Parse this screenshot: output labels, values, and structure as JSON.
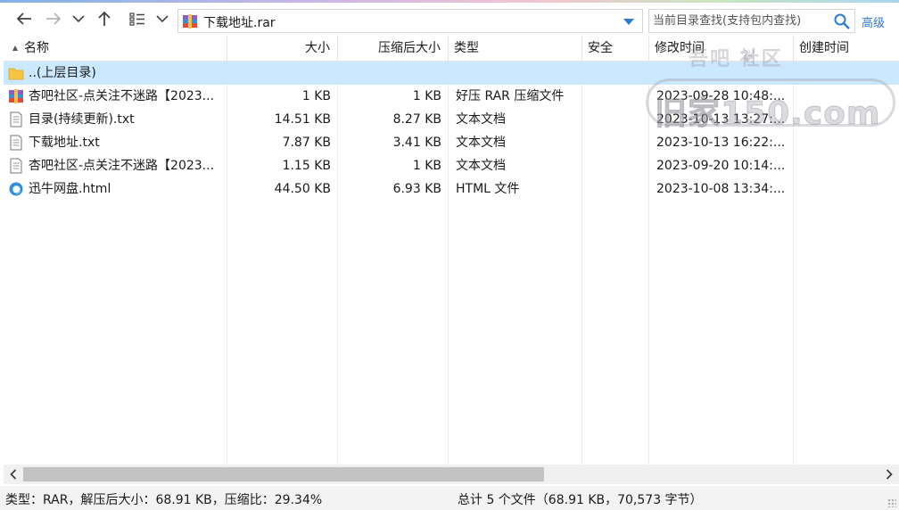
{
  "toolbar": {
    "address": "下载地址.rar",
    "search_placeholder": "当前目录查找(支持包内查找)",
    "advanced_label": "高级"
  },
  "columns": {
    "name": "名称",
    "size": "大小",
    "packed": "压缩后大小",
    "type": "类型",
    "security": "安全",
    "modified": "修改时间",
    "created": "创建时间"
  },
  "files": [
    {
      "name": "..(上层目录)",
      "size": "",
      "packed": "",
      "type": "",
      "security": "",
      "modified": "",
      "created": "",
      "icon": "folder-icon"
    },
    {
      "name": "杏吧社区-点关注不迷路【2023...",
      "size": "1 KB",
      "packed": "1 KB",
      "type": "好压 RAR 压缩文件",
      "security": "",
      "modified": "2023-09-28 10:48:...",
      "created": "",
      "icon": "rar-icon"
    },
    {
      "name": "目录(持续更新).txt",
      "size": "14.51 KB",
      "packed": "8.27 KB",
      "type": "文本文档",
      "security": "",
      "modified": "2023-10-13 13:27:...",
      "created": "",
      "icon": "text-file-icon"
    },
    {
      "name": "下载地址.txt",
      "size": "7.87 KB",
      "packed": "3.41 KB",
      "type": "文本文档",
      "security": "",
      "modified": "2023-10-13 16:22:...",
      "created": "",
      "icon": "text-file-icon"
    },
    {
      "name": "杏吧社区-点关注不迷路【2023...",
      "size": "1.15 KB",
      "packed": "1 KB",
      "type": "文本文档",
      "security": "",
      "modified": "2023-09-20 10:14:...",
      "created": "",
      "icon": "text-file-icon"
    },
    {
      "name": "迅牛网盘.html",
      "size": "44.50 KB",
      "packed": "6.93 KB",
      "type": "HTML 文件",
      "security": "",
      "modified": "2023-10-08 13:34:...",
      "created": "",
      "icon": "browser-icon"
    }
  ],
  "status": {
    "left": "类型：RAR，解压后大小：68.91 KB，压缩比：29.34%",
    "middle": "总计 5 个文件（68.91 KB，70,573 字节）"
  },
  "watermark": {
    "line1": "吾吧 社区",
    "line2": "旧家150.com"
  },
  "colors": {
    "accent": "#2a7bd5",
    "selected_row": "#cce8ff",
    "status_bg": "#f3f3f3"
  }
}
